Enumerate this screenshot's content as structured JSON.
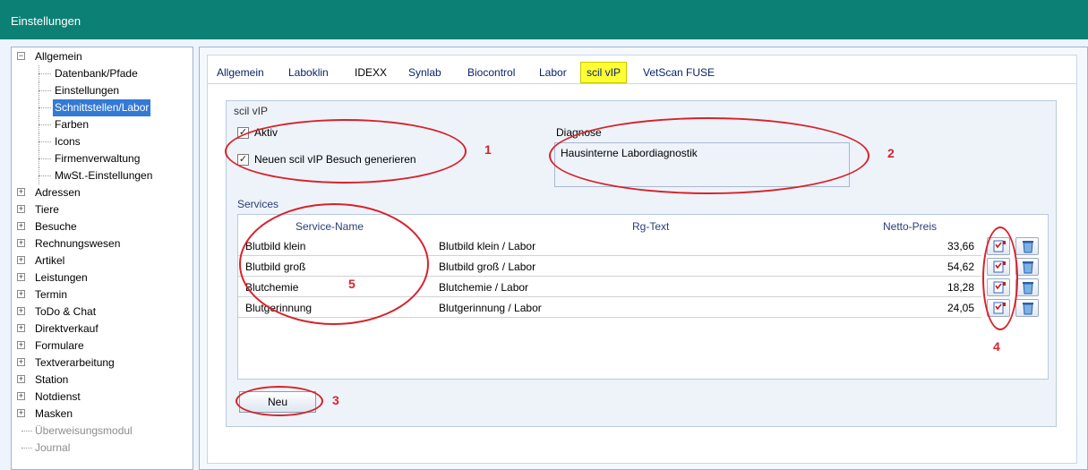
{
  "window": {
    "title": "Einstellungen"
  },
  "tree": {
    "items": [
      {
        "label": "Allgemein",
        "level": 0,
        "expander": "minus"
      },
      {
        "label": "Datenbank/Pfade",
        "level": 1
      },
      {
        "label": "Einstellungen",
        "level": 1
      },
      {
        "label": "Schnittstellen/Labor",
        "level": 1,
        "selected": true
      },
      {
        "label": "Farben",
        "level": 1
      },
      {
        "label": "Icons",
        "level": 1
      },
      {
        "label": "Firmenverwaltung",
        "level": 1
      },
      {
        "label": "MwSt.-Einstellungen",
        "level": 1
      },
      {
        "label": "Adressen",
        "level": 0,
        "expander": "plus"
      },
      {
        "label": "Tiere",
        "level": 0,
        "expander": "plus"
      },
      {
        "label": "Besuche",
        "level": 0,
        "expander": "plus"
      },
      {
        "label": "Rechnungswesen",
        "level": 0,
        "expander": "plus"
      },
      {
        "label": "Artikel",
        "level": 0,
        "expander": "plus"
      },
      {
        "label": "Leistungen",
        "level": 0,
        "expander": "plus"
      },
      {
        "label": "Termin",
        "level": 0,
        "expander": "plus"
      },
      {
        "label": "ToDo & Chat",
        "level": 0,
        "expander": "plus"
      },
      {
        "label": "Direktverkauf",
        "level": 0,
        "expander": "plus"
      },
      {
        "label": "Formulare",
        "level": 0,
        "expander": "plus"
      },
      {
        "label": "Textverarbeitung",
        "level": 0,
        "expander": "plus"
      },
      {
        "label": "Station",
        "level": 0,
        "expander": "plus"
      },
      {
        "label": "Notdienst",
        "level": 0,
        "expander": "plus"
      },
      {
        "label": "Masken",
        "level": 0,
        "expander": "plus"
      },
      {
        "label": "Überweisungsmodul",
        "level": 0,
        "disabled": true
      },
      {
        "label": "Journal",
        "level": 0,
        "disabled": true
      }
    ]
  },
  "tabs": [
    {
      "label": "Allgemein"
    },
    {
      "label": "Laboklin"
    },
    {
      "label": "IDEXX"
    },
    {
      "label": "Synlab"
    },
    {
      "label": "Biocontrol"
    },
    {
      "label": "Labor"
    },
    {
      "label": "scil vIP",
      "active": true
    },
    {
      "label": "VetScan FUSE"
    }
  ],
  "scil": {
    "group_title": "scil vIP",
    "aktiv_label": "Aktiv",
    "aktiv_checked": true,
    "besuch_label": "Neuen scil vIP Besuch generieren",
    "besuch_checked": true,
    "diagnose_label": "Diagnose",
    "diagnose_value": "Hausinterne Labordiagnostik",
    "services_label": "Services",
    "columns": {
      "name": "Service-Name",
      "rg": "Rg-Text",
      "price": "Netto-Preis"
    },
    "services": [
      {
        "name": "Blutbild klein",
        "rg": "Blutbild klein / Labor",
        "price": "33,66"
      },
      {
        "name": "Blutbild groß",
        "rg": "Blutbild groß / Labor",
        "price": "54,62"
      },
      {
        "name": "Blutchemie",
        "rg": "Blutchemie / Labor",
        "price": "18,28"
      },
      {
        "name": "Blutgerinnung",
        "rg": "Blutgerinnung / Labor",
        "price": "24,05"
      }
    ],
    "new_button": "Neu"
  },
  "annotations": {
    "n1": "1",
    "n2": "2",
    "n3": "3",
    "n4": "4",
    "n5": "5",
    "color": "#d8222a"
  },
  "colors": {
    "titlebar": "#0d8076",
    "selection": "#3479d4",
    "active_tab": "#ffff33"
  }
}
